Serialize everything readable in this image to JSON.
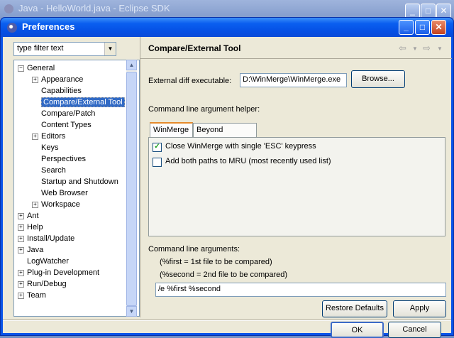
{
  "background_window": {
    "title": "Java - HelloWorld.java - Eclipse SDK"
  },
  "dialog": {
    "title": "Preferences",
    "buttons": {
      "minimize": "_",
      "maximize": "□",
      "close": "✕"
    }
  },
  "filter": {
    "value": "type filter text"
  },
  "tree": {
    "nodes": [
      {
        "label": "General",
        "toggle": "−"
      },
      {
        "label": "Appearance",
        "toggle": "+"
      },
      {
        "label": "Capabilities"
      },
      {
        "label": "Compare/External Tool",
        "selected": true
      },
      {
        "label": "Compare/Patch"
      },
      {
        "label": "Content Types"
      },
      {
        "label": "Editors",
        "toggle": "+"
      },
      {
        "label": "Keys"
      },
      {
        "label": "Perspectives"
      },
      {
        "label": "Search"
      },
      {
        "label": "Startup and Shutdown"
      },
      {
        "label": "Web Browser"
      },
      {
        "label": "Workspace",
        "toggle": "+"
      },
      {
        "label": "Ant",
        "toggle": "+"
      },
      {
        "label": "Help",
        "toggle": "+"
      },
      {
        "label": "Install/Update",
        "toggle": "+"
      },
      {
        "label": "Java",
        "toggle": "+"
      },
      {
        "label": "LogWatcher"
      },
      {
        "label": "Plug-in Development",
        "toggle": "+"
      },
      {
        "label": "Run/Debug",
        "toggle": "+"
      },
      {
        "label": "Team",
        "toggle": "+"
      }
    ]
  },
  "page": {
    "title": "Compare/External Tool",
    "external_diff_label": "External diff executable:",
    "external_diff_value": "D:\\WinMerge\\WinMerge.exe",
    "browse_label": "Browse...",
    "helper_label": "Command line argument helper:",
    "tabs": [
      "WinMerge",
      "Beyond Compare"
    ],
    "options": [
      {
        "label": "Close WinMerge with single 'ESC' keypress",
        "checked": true
      },
      {
        "label": "Add both paths to MRU (most recently used list)",
        "checked": false
      }
    ],
    "args_label": "Command line arguments:",
    "hint1": "(%first = 1st file to be compared)",
    "hint2": "(%second = 2nd file to be compared)",
    "args_value": "/e %first %second",
    "restore_label": "Restore Defaults",
    "apply_label": "Apply"
  },
  "footer": {
    "ok_label": "OK",
    "cancel_label": "Cancel"
  }
}
